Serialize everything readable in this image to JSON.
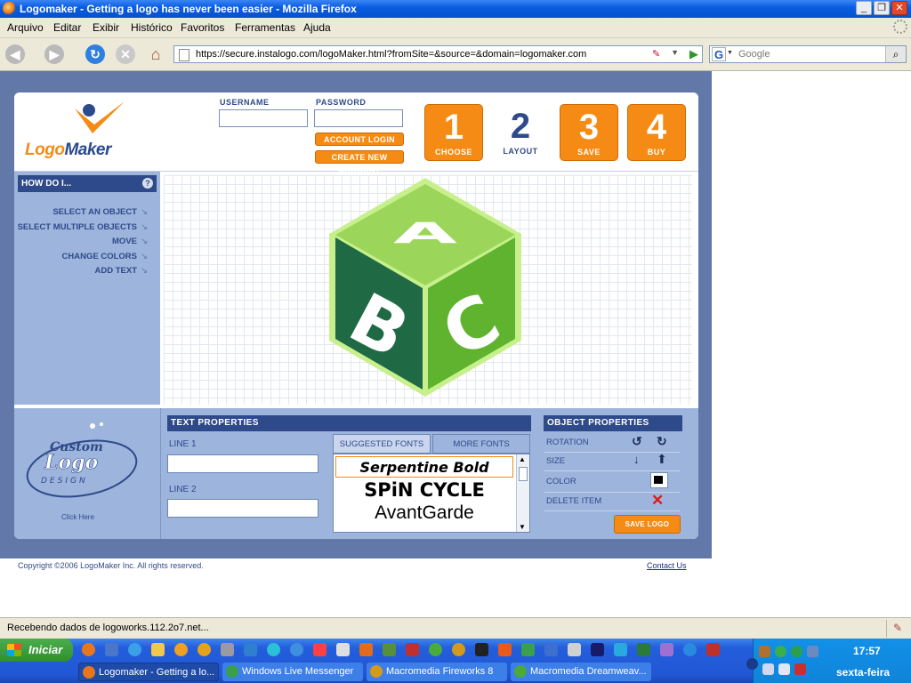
{
  "browser": {
    "window_title": "Logomaker - Getting a logo has never been easier - Mozilla Firefox",
    "menu": [
      "Arquivo",
      "Editar",
      "Exibir",
      "Histórico",
      "Favoritos",
      "Ferramentas",
      "Ajuda"
    ],
    "url": "https://secure.instalogo.com/logoMaker.html?fromSite=&source=&domain=logomaker.com",
    "search_placeholder": "Google",
    "status": "Recebendo dados de logoworks.112.2o7.net..."
  },
  "header": {
    "logo_part1": "Logo",
    "logo_part2": "Maker",
    "username_label": "USERNAME",
    "password_label": "PASSWORD",
    "account_login": "ACCOUNT LOGIN",
    "create_account": "CREATE NEW ACCOUNT",
    "steps": [
      {
        "num": "1",
        "label": "CHOOSE"
      },
      {
        "num": "2",
        "label": "LAYOUT"
      },
      {
        "num": "3",
        "label": "SAVE"
      },
      {
        "num": "4",
        "label": "BUY"
      }
    ]
  },
  "help": {
    "title": "HOW DO I...",
    "items": [
      "SELECT AN OBJECT",
      "SELECT MULTIPLE OBJECTS",
      "MOVE",
      "CHANGE COLORS",
      "ADD TEXT"
    ]
  },
  "canvas": {
    "letters": [
      "A",
      "B",
      "C"
    ],
    "colors": {
      "top": "#9bd65a",
      "left": "#1f6a44",
      "right": "#5fb32f",
      "outline": "#c7f08d"
    }
  },
  "custom_logo": {
    "line1": "Custom",
    "line2": "Logo",
    "line3": "DESIGN",
    "click_here": "Click Here"
  },
  "text_properties": {
    "title": "TEXT PROPERTIES",
    "line1_label": "LINE 1",
    "line2_label": "LINE 2",
    "tab_suggested": "SUGGESTED FONTS",
    "tab_more": "MORE FONTS",
    "fonts": [
      "Serpentine Bold",
      "SPiN CYCLE",
      "AvantGarde"
    ]
  },
  "object_properties": {
    "title": "OBJECT PROPERTIES",
    "rotation": "ROTATION",
    "size": "SIZE",
    "color": "COLOR",
    "delete": "DELETE ITEM",
    "save_logo": "SAVE LOGO"
  },
  "footer": {
    "copyright": "Copyright ©2006 LogoMaker Inc. All rights reserved.",
    "contact": "Contact Us"
  },
  "taskbar": {
    "start": "Iniciar",
    "tasks": [
      "Logomaker - Getting a lo...",
      "Windows Live Messenger",
      "Macromedia Fireworks 8",
      "Macromedia Dreamweav..."
    ],
    "time": "17:57",
    "day": "sexta-feira"
  }
}
